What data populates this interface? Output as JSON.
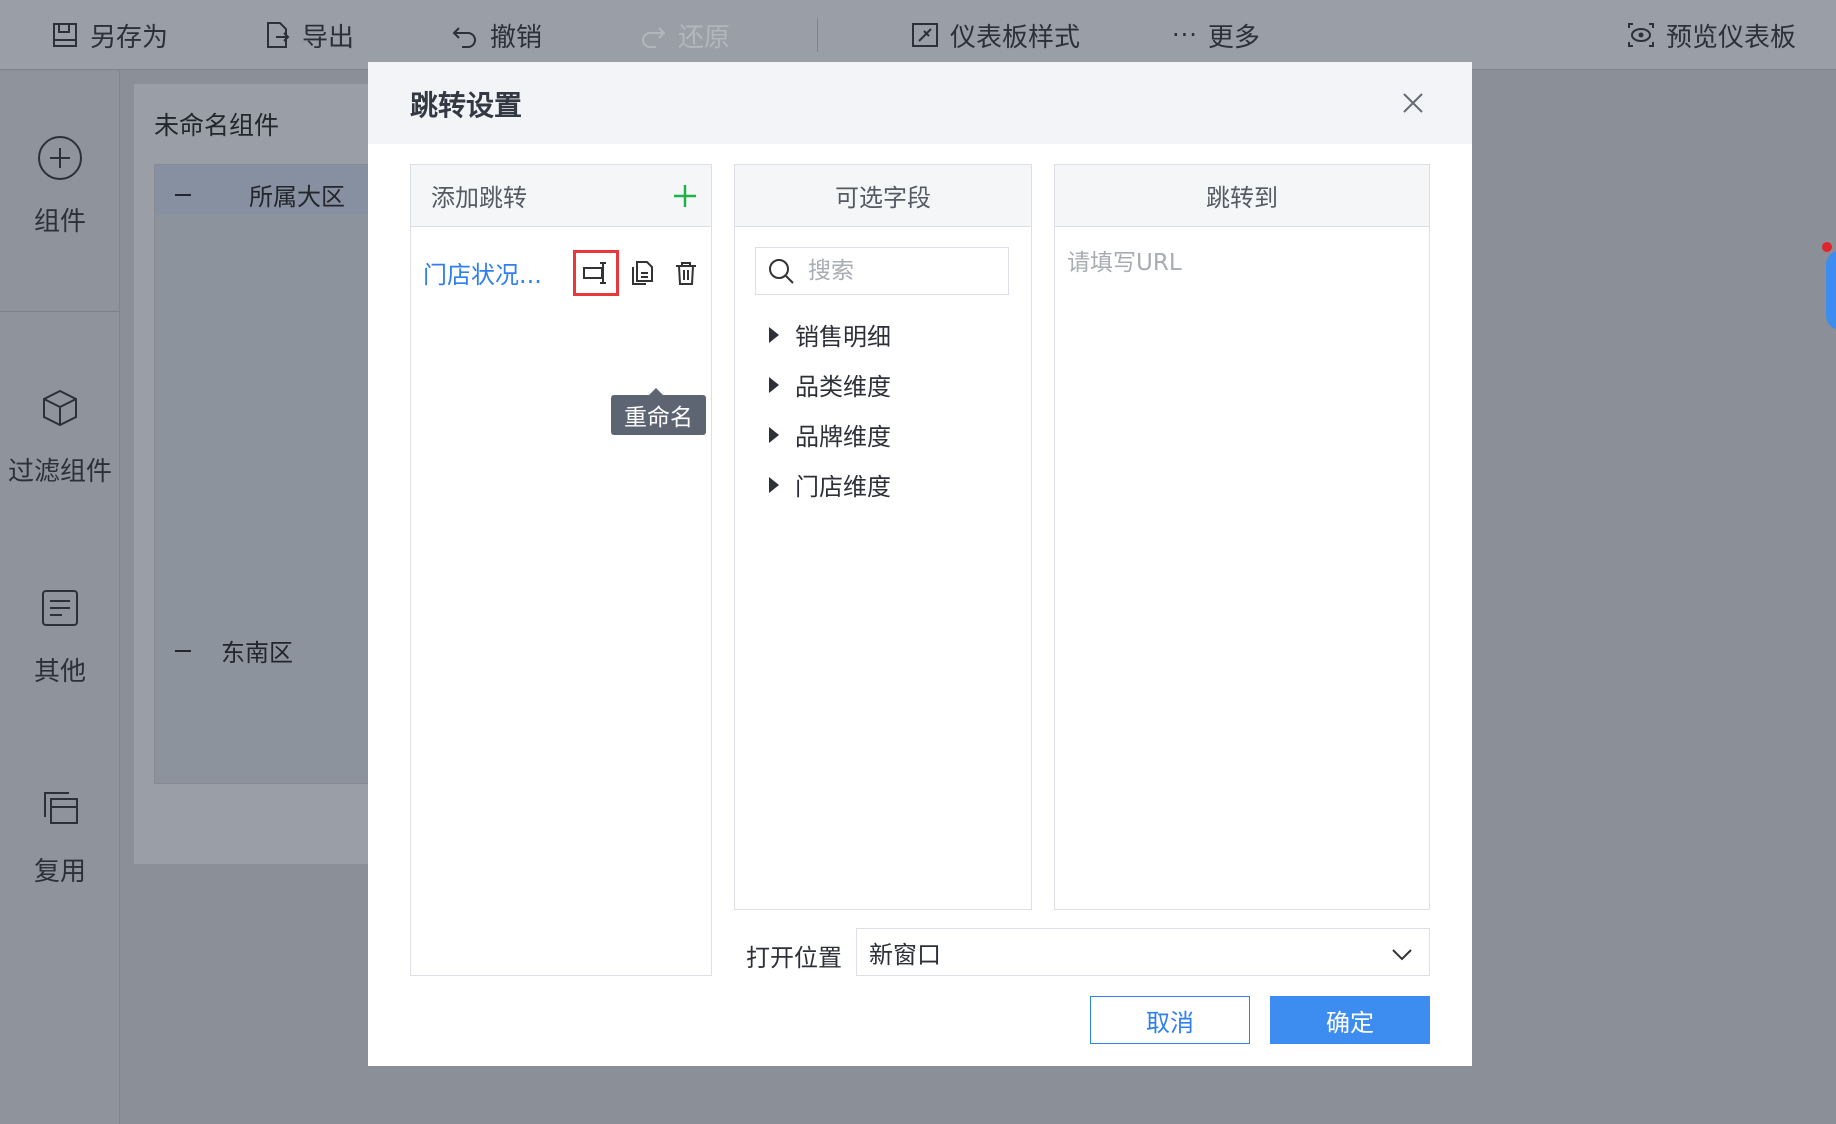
{
  "toolbar": {
    "save_as": "另存为",
    "export": "导出",
    "undo": "撤销",
    "redo": "还原",
    "dashboard_style": "仪表板样式",
    "more": "更多",
    "preview": "预览仪表板"
  },
  "sidebar": {
    "items": [
      {
        "label": "组件",
        "icon": "plus-circle-icon"
      },
      {
        "label": "过滤组件",
        "icon": "cube-icon"
      },
      {
        "label": "其他",
        "icon": "document-icon"
      },
      {
        "label": "复用",
        "icon": "copy-icon"
      }
    ]
  },
  "canvas": {
    "component_title": "未命名组件",
    "tree_header": "所属大区",
    "tree_row": "东南区"
  },
  "modal": {
    "title": "跳转设置",
    "add_jump_label": "添加跳转",
    "jump_item_name": "门店状况...",
    "tooltip_rename": "重命名",
    "fields_header": "可选字段",
    "search_placeholder": "搜索",
    "fields": [
      "销售明细",
      "品类维度",
      "品牌维度",
      "门店维度"
    ],
    "target_header": "跳转到",
    "url_placeholder": "请填写URL",
    "open_position_label": "打开位置",
    "open_position_value": "新窗口",
    "cancel_label": "取消",
    "ok_label": "确定"
  },
  "colors": {
    "accent": "#3d8cf0",
    "add_green": "#22b04a",
    "highlight_red": "#e8383d"
  }
}
